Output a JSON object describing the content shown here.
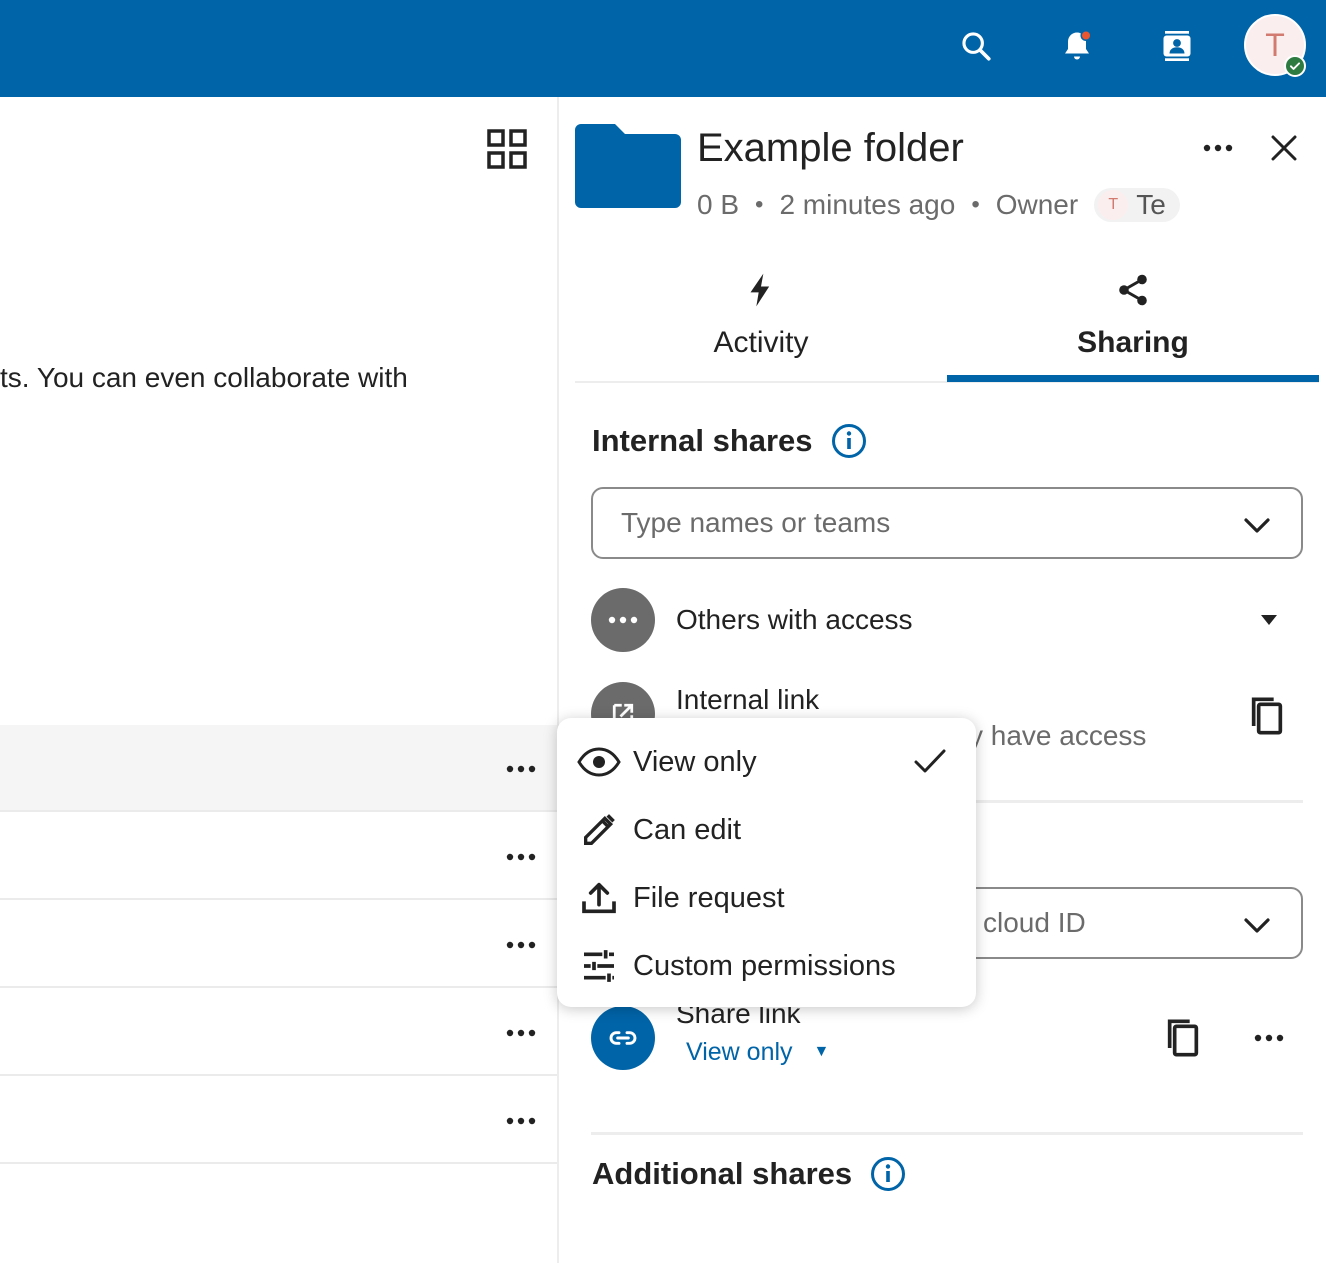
{
  "header": {
    "search_icon": "search-icon",
    "notifications_icon": "bell-icon",
    "contacts_icon": "contacts-icon",
    "user_initial": "T",
    "brand_color": "#0064a8"
  },
  "files": {
    "intro_text": "ts. You can even collaborate with"
  },
  "sidebar": {
    "title": "Example folder",
    "size": "0 B",
    "modified": "2 minutes ago",
    "owner_label": "Owner",
    "owner_initial": "T",
    "owner_name": "Te",
    "tabs": [
      {
        "label": "Activity",
        "icon": "lightning-icon"
      },
      {
        "label": "Sharing",
        "icon": "share-icon"
      }
    ],
    "internal_shares": {
      "title": "Internal shares",
      "search_placeholder": "Type names or teams",
      "others_label": "Others with access",
      "internal_link_label": "Internal link",
      "internal_link_sub_partial": "y have access"
    },
    "external_shares": {
      "search_partial": "cloud ID",
      "share_link_label": "Share link",
      "permission_label": "View only"
    },
    "additional_shares": {
      "title": "Additional shares"
    }
  },
  "permission_menu": {
    "items": [
      {
        "label": "View only",
        "icon": "eye-icon",
        "selected": true
      },
      {
        "label": "Can edit",
        "icon": "pencil-icon",
        "selected": false
      },
      {
        "label": "File request",
        "icon": "upload-icon",
        "selected": false
      },
      {
        "label": "Custom permissions",
        "icon": "tune-icon",
        "selected": false
      }
    ]
  }
}
